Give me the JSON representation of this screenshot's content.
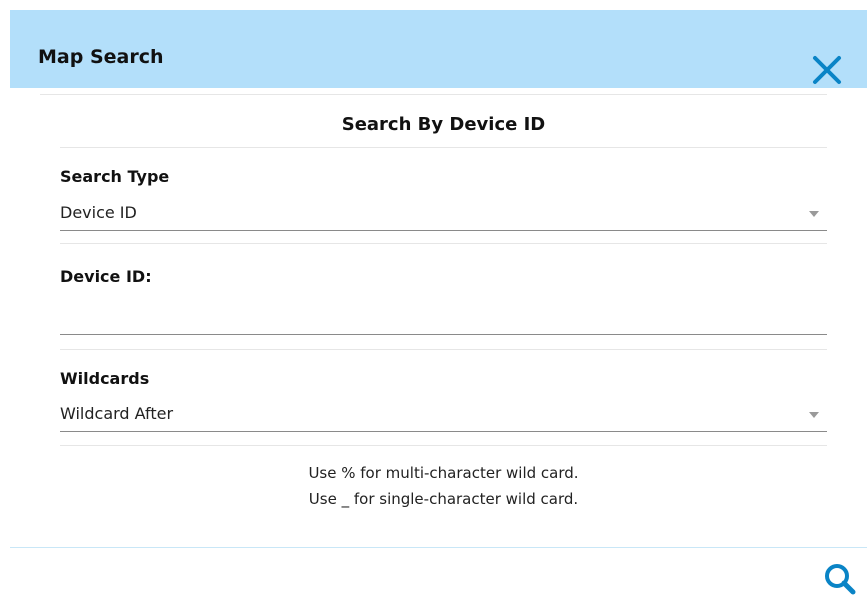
{
  "header": {
    "title": "Map Search",
    "close_icon": "close-icon"
  },
  "section": {
    "title": "Search By Device ID"
  },
  "search_type": {
    "label": "Search Type",
    "value": "Device ID"
  },
  "device_id": {
    "label": "Device ID:",
    "value": ""
  },
  "wildcards": {
    "label": "Wildcards",
    "value": "Wildcard After"
  },
  "help": {
    "line1": "Use % for multi-character wild card.",
    "line2": "Use _ for single-character wild card."
  },
  "footer": {
    "search_icon": "search-icon"
  },
  "colors": {
    "header_bg": "#b3dffa",
    "accent": "#0a84c6"
  }
}
